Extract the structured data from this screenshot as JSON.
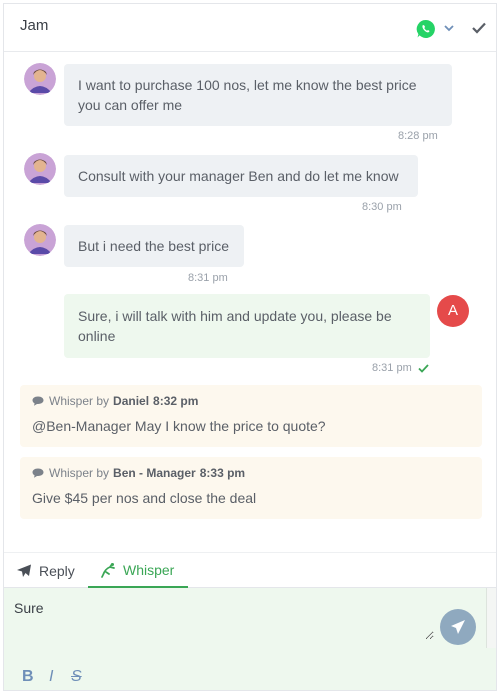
{
  "header": {
    "title": "Jam",
    "channel_icon": "whatsapp-icon",
    "accent": "#25d366"
  },
  "messages": [
    {
      "text": "I want to purchase 100 nos, let me know the best price you can offer me",
      "time": "8:28 pm"
    },
    {
      "text": "Consult with your manager Ben and do let me know",
      "time": "8:30 pm"
    },
    {
      "text": "But i need the best price",
      "time": "8:31 pm"
    }
  ],
  "agent_message": {
    "avatar_initial": "A",
    "text": "Sure, i will talk with him and update you, please be online",
    "time": "8:31 pm"
  },
  "whispers": [
    {
      "prefix": "Whisper by",
      "author": "Daniel",
      "time": "8:32 pm",
      "text": "@Ben-Manager May I know the price to quote?"
    },
    {
      "prefix": "Whisper by",
      "author": "Ben - Manager",
      "time": "8:33 pm",
      "text": "Give $45 per nos and close the deal"
    }
  ],
  "composer": {
    "tabs": {
      "reply": "Reply",
      "whisper": "Whisper"
    },
    "active_tab": "Whisper",
    "input_value": "Sure",
    "format": {
      "bold": "B",
      "italic": "I",
      "strike": "S"
    }
  }
}
